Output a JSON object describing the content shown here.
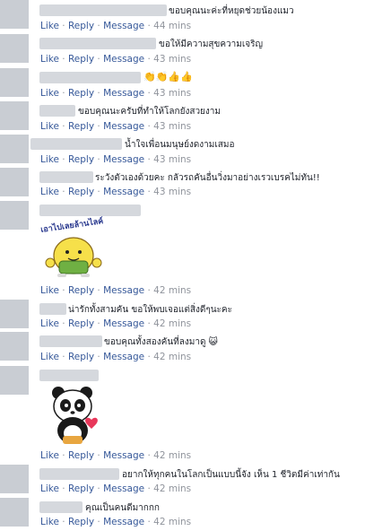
{
  "actions": {
    "like": "Like",
    "reply": "Reply",
    "message": "Message",
    "sep": "·"
  },
  "comments": [
    {
      "text": "ขอบคุณนะค่ะที่หยุดช่วยน้องแมว",
      "time": "44 mins"
    },
    {
      "text": "ขอให้มีความสุขความเจริญ",
      "time": "43 mins"
    },
    {
      "text": "👏👏👍👍",
      "time": "43 mins"
    },
    {
      "text": "ขอบคุณนะครับที่ทำให้โลกยังสวยงาม",
      "time": "43 mins"
    },
    {
      "text": "น้ำใจเพื่อนมนุษย์งดงามเสมอ",
      "time": "43 mins"
    },
    {
      "text": "ระวังตัวเองด้วยคะ กลัวรถคันอื่นวิ่งมาอย่างเรวเบรคไม่ทัน!!",
      "time": "43 mins"
    },
    {
      "text": "เอาไปเลยล้านไลค์",
      "time": "42 mins"
    },
    {
      "text": "น่ารักทั้งสามคัน ขอให้พบเจอแต่สิ่งดีๆนะคะ",
      "time": "42 mins"
    },
    {
      "text": "ขอบคุณทั้งสองคันที่ลงมาดู 😺",
      "time": "42 mins"
    },
    {
      "text": "",
      "time": "42 mins"
    },
    {
      "text": "อยากให้ทุกคนในโลกเป็นแบบนี้จัง เห็น 1 ชีวิตมีค่าเท่ากัน",
      "time": "42 mins"
    },
    {
      "text": "คุณเป็นคนดีมากกก",
      "time": "42 mins"
    }
  ]
}
